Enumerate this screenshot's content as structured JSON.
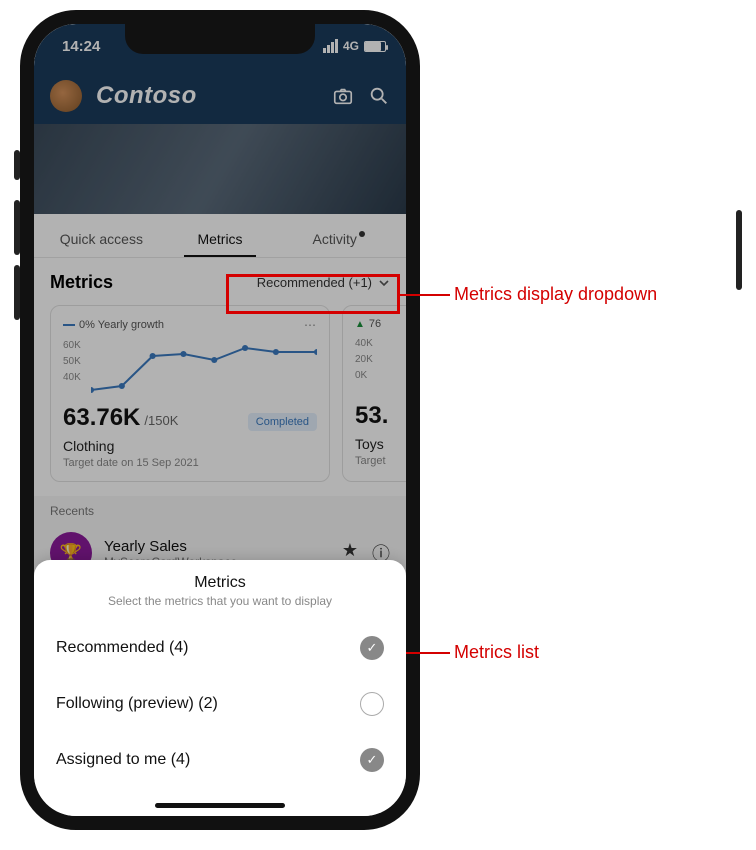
{
  "status": {
    "time": "14:24",
    "network": "4G"
  },
  "header": {
    "brand": "Contoso"
  },
  "tabs": {
    "quick": "Quick access",
    "metrics": "Metrics",
    "activity": "Activity"
  },
  "section": {
    "title": "Metrics",
    "dropdown": "Recommended (+1)"
  },
  "card1": {
    "trend": "0% Yearly growth",
    "y1": "60K",
    "y2": "50K",
    "y3": "40K",
    "value": "63.76K",
    "target": "/150K",
    "badge": "Completed",
    "title": "Clothing",
    "sub": "Target date on 15 Sep 2021"
  },
  "card2": {
    "trend": "76",
    "y1": "40K",
    "y2": "20K",
    "y3": "0K",
    "value": "53.",
    "title": "Toys",
    "sub": "Target"
  },
  "recents": {
    "label": "Recents",
    "item1": {
      "title": "Yearly Sales",
      "sub": "MyScoreCardWorkspace"
    }
  },
  "sheet": {
    "title": "Metrics",
    "subtitle": "Select the metrics that you want to display",
    "opt1": "Recommended (4)",
    "opt2": "Following (preview) (2)",
    "opt3": "Assigned to me (4)"
  },
  "annotations": {
    "dropdown": "Metrics display dropdown",
    "list": "Metrics list"
  },
  "chart_data": {
    "type": "line",
    "title": "Clothing — Yearly growth",
    "ylabel": "",
    "ylim": [
      40000,
      60000
    ],
    "y_ticks": [
      40000,
      50000,
      60000
    ],
    "x": [
      1,
      2,
      3,
      4,
      5,
      6,
      7,
      8
    ],
    "values": [
      42000,
      44000,
      56000,
      57000,
      55000,
      59000,
      58000,
      58000
    ],
    "current_value": 63760,
    "target_value": 150000,
    "status": "Completed",
    "trend_pct": 0
  }
}
